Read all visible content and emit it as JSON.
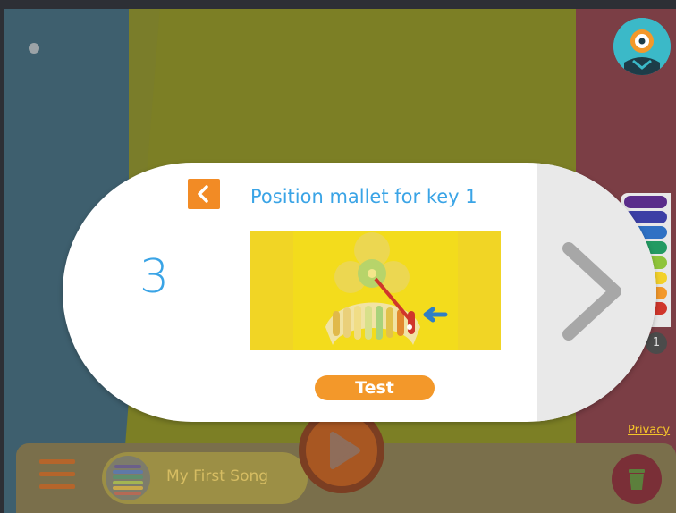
{
  "dialog": {
    "step_number": "3",
    "title": "Position mallet for key 1",
    "test_button": "Test",
    "image_icon": "xylophone-mallet-illustration",
    "back_icon": "chevron-left-icon",
    "next_icon": "chevron-right-icon"
  },
  "footer": {
    "song_title": "My First Song",
    "menu_icon": "hamburger-menu-icon",
    "play_icon": "play-icon",
    "trash_icon": "trash-icon"
  },
  "sidebar": {
    "badge_count": "1",
    "xylophone_colors": [
      "#5a2c8a",
      "#3c3fa5",
      "#2f71c4",
      "#239a62",
      "#8fc43a",
      "#f3d12a",
      "#f3982a",
      "#d0362b"
    ]
  },
  "links": {
    "privacy": "Privacy"
  },
  "colors": {
    "accent_blue": "#3aa4e6",
    "accent_orange": "#f3982a",
    "image_bg": "#f3dc1c"
  }
}
